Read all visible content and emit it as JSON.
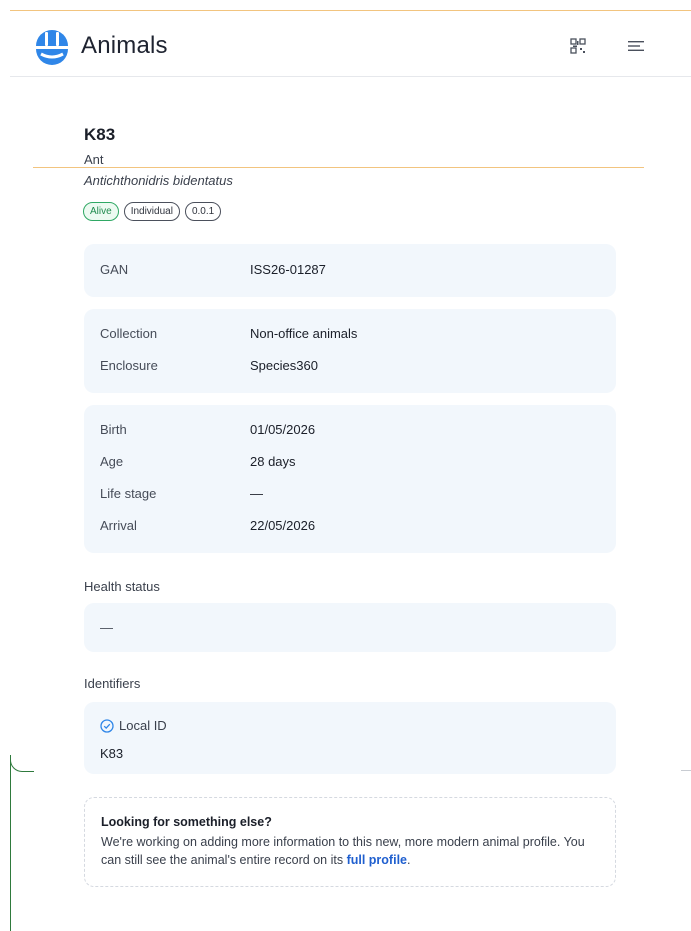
{
  "header": {
    "app_title": "Animals",
    "logo_icon": "animals-logo-icon",
    "qr_icon": "qr-code-icon",
    "menu_icon": "menu-icon"
  },
  "animal": {
    "name": "K83",
    "common_name": "Ant",
    "scientific_name": "Antichthonidris bidentatus",
    "badges": [
      "Alive",
      "Individual",
      "0.0.1"
    ]
  },
  "cards": {
    "gan": {
      "label": "GAN",
      "value": "ISS26-01287"
    },
    "collection": {
      "label": "Collection",
      "value": "Non-office animals"
    },
    "enclosure": {
      "label": "Enclosure",
      "value": "Species360"
    },
    "birth": {
      "label": "Birth",
      "value": "01/05/2026"
    },
    "age": {
      "label": "Age",
      "value": "28 days"
    },
    "life_stage": {
      "label": "Life stage",
      "value": "—"
    },
    "arrival": {
      "label": "Arrival",
      "value": "22/05/2026"
    }
  },
  "health": {
    "label": "Health status",
    "value": "—"
  },
  "identifiers": {
    "label": "Identifiers",
    "items": [
      {
        "type": "Local ID",
        "value": "K83",
        "icon": "check-circle-icon"
      }
    ]
  },
  "note": {
    "title": "Looking for something else?",
    "body": "We're working on adding more information to this new, more modern animal profile. You can still see the animal's entire record on its",
    "link_text": "full profile",
    "end": "."
  },
  "colors": {
    "accent_line": "#f2c47f",
    "brand_blue": "#2f86e8",
    "card_bg": "#f2f7fc",
    "alive_green": "#2fa864",
    "link_blue": "#1f5fcf"
  }
}
